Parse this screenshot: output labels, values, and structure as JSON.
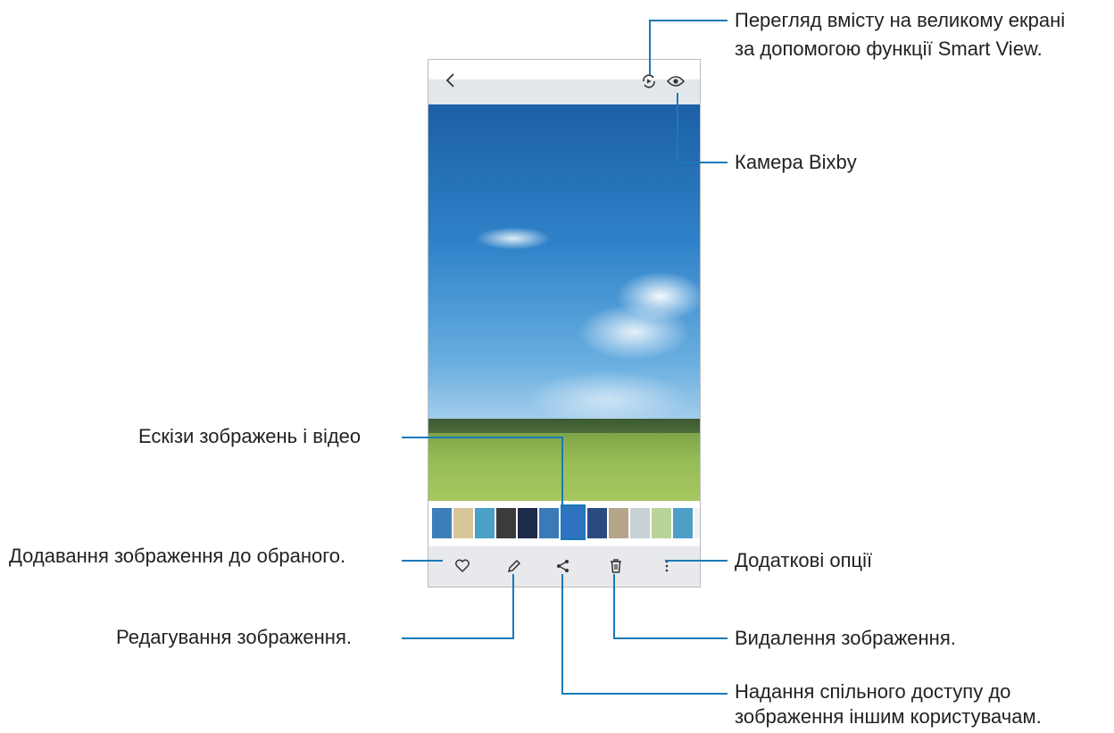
{
  "annotations": {
    "smart_view": [
      "Перегляд вмісту на великому екрані",
      "за допомогою функції Smart View."
    ],
    "bixby_camera": "Камера Bixby",
    "thumbnails": "Ескізи зображень і відео",
    "favorite": "Додавання зображення до обраного.",
    "more_options": "Додаткові опції",
    "edit": "Редагування зображення.",
    "delete": "Видалення зображення.",
    "share": [
      "Надання спільного доступу до",
      "зображення іншим користувачам."
    ]
  },
  "top_bar": {
    "back_icon": "back-chevron",
    "smart_view_icon": "smart-view",
    "bixby_icon": "eye"
  },
  "thumbnail_colors": [
    "#3c7fb8",
    "#d8c69b",
    "#4aa0c6",
    "#3b3b3b",
    "#1e2a4a",
    "#3a7ab8",
    "#2d73bf",
    "#2b4b80",
    "#b7a58a",
    "#c8d1d6",
    "#b9d39a",
    "#4d9fc8",
    "#f2f2f2"
  ],
  "toolbar": {
    "icons": [
      "heart",
      "pencil",
      "share",
      "trash",
      "more-vertical"
    ]
  }
}
